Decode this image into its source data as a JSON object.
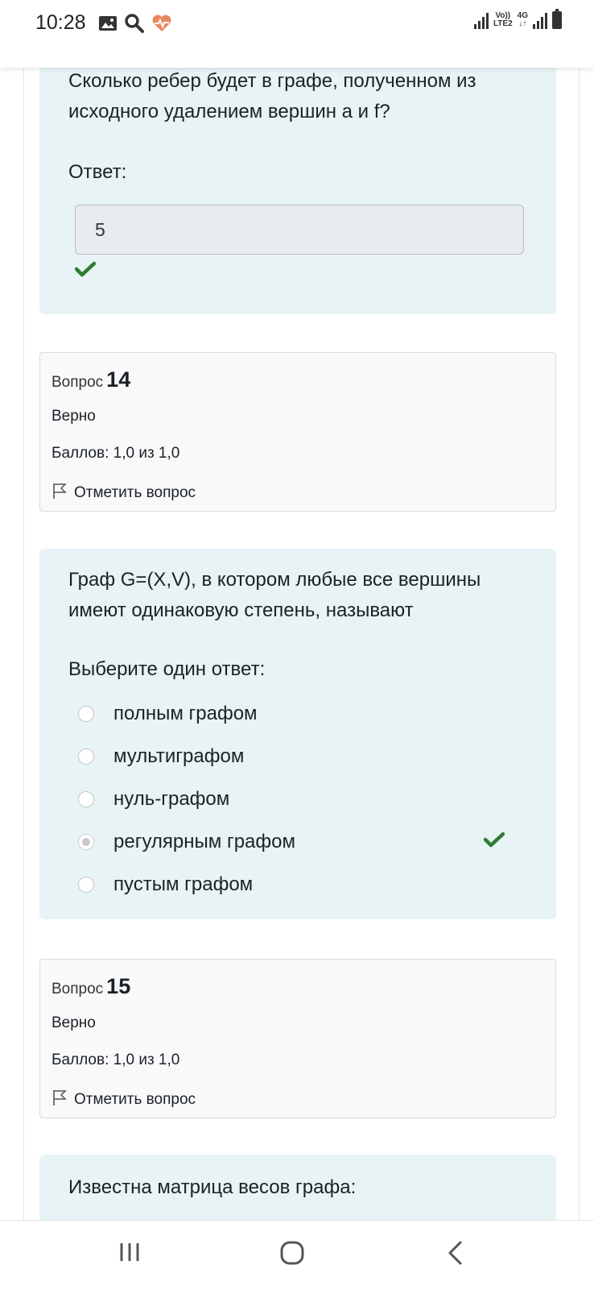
{
  "status_bar": {
    "time": "10:28",
    "icons_left": [
      "image-icon",
      "search-icon",
      "heart-rate-icon"
    ],
    "network_top": "Vo))",
    "network_bottom": "LTE2",
    "net_4g": "4G"
  },
  "question13": {
    "text": "Сколько ребер будет в графе, полученном из исходного удалением вершин a и f?",
    "answer_label": "Ответ:",
    "answer_value": "5"
  },
  "info14": {
    "label": "Вопрос",
    "number": "14",
    "status": "Верно",
    "score": "Баллов: 1,0 из 1,0",
    "flag_label": "Отметить вопрос"
  },
  "question14": {
    "text": "Граф G=(X,V), в котором любые все вершины имеют одинаковую степень, называют",
    "prompt": "Выберите один ответ:",
    "options": [
      {
        "label": "полным графом",
        "selected": false
      },
      {
        "label": "мультиграфом",
        "selected": false
      },
      {
        "label": "нуль-графом",
        "selected": false
      },
      {
        "label": "регулярным графом",
        "selected": true
      },
      {
        "label": "пустым графом",
        "selected": false
      }
    ]
  },
  "info15": {
    "label": "Вопрос",
    "number": "15",
    "status": "Верно",
    "score": "Баллов: 1,0 из 1,0",
    "flag_label": "Отметить вопрос"
  },
  "question15": {
    "text": "Известна матрица весов графа:"
  },
  "colors": {
    "card_bg": "#e7f3f5",
    "info_bg": "#f8f9fa",
    "check_green": "#2e7d32"
  }
}
